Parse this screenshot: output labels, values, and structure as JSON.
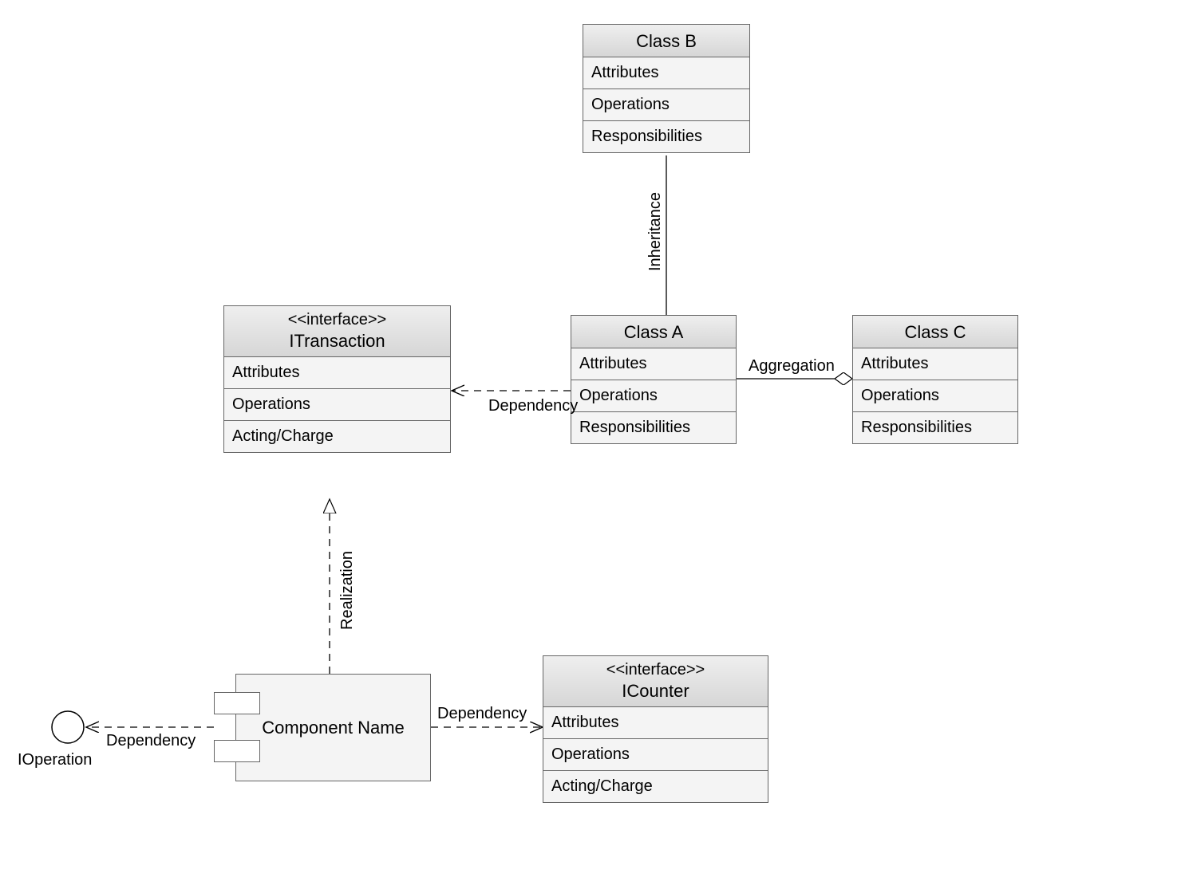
{
  "classes": {
    "classB": {
      "name": "Class B",
      "rows": [
        "Attributes",
        "Operations",
        "Responsibilities"
      ]
    },
    "classA": {
      "name": "Class A",
      "rows": [
        "Attributes",
        "Operations",
        "Responsibilities"
      ]
    },
    "classC": {
      "name": "Class C",
      "rows": [
        "Attributes",
        "Operations",
        "Responsibilities"
      ]
    },
    "itransaction": {
      "stereotype": "<<interface>>",
      "name": "ITransaction",
      "rows": [
        "Attributes",
        "Operations",
        "Acting/Charge"
      ]
    },
    "icounter": {
      "stereotype": "<<interface>>",
      "name": "ICounter",
      "rows": [
        "Attributes",
        "Operations",
        "Acting/Charge"
      ]
    }
  },
  "component": {
    "name": "Component Name"
  },
  "lollipop": {
    "name": "IOperation"
  },
  "relations": {
    "inheritance": "Inheritance",
    "aggregation": "Aggregation",
    "dependency_a_itx": "Dependency",
    "realization": "Realization",
    "dependency_comp_icounter": "Dependency",
    "dependency_comp_iop": "Dependency"
  }
}
